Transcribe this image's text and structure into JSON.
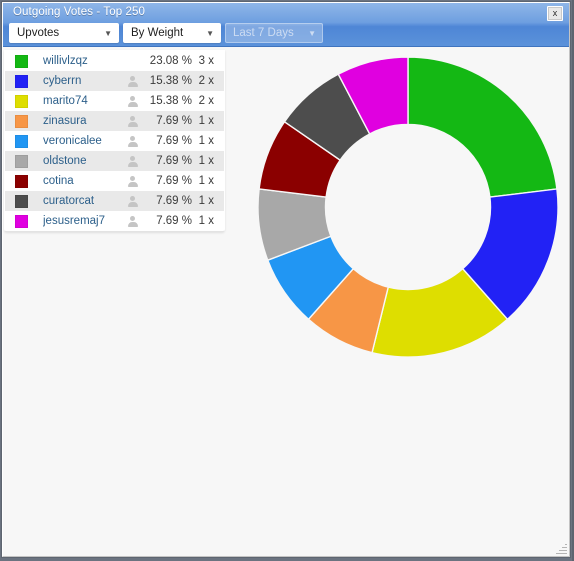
{
  "window": {
    "title": "Outgoing Votes - Top 250",
    "close_label": "x",
    "close_icon": "close-icon",
    "resize_grip_icon": "resize-grip-icon"
  },
  "toolbar": {
    "vote_type": {
      "value": "Upvotes",
      "arrow_icon": "chevron-down-icon"
    },
    "sort_mode": {
      "value": "By Weight",
      "arrow_icon": "chevron-down-icon"
    },
    "time_range": {
      "value": "Last 7 Days",
      "arrow_icon": "chevron-down-icon",
      "disabled": true
    }
  },
  "legend": {
    "rows": [
      {
        "color": "#14b814",
        "username": "willivlzqz",
        "percent": "23.08 %",
        "count": "3 x",
        "has_avatar": false,
        "avatar_icon": "person-icon"
      },
      {
        "color": "#2222f5",
        "username": "cyberrn",
        "percent": "15.38 %",
        "count": "2 x",
        "has_avatar": true,
        "avatar_icon": "person-icon"
      },
      {
        "color": "#dede00",
        "username": "marito74",
        "percent": "15.38 %",
        "count": "2 x",
        "has_avatar": true,
        "avatar_icon": "person-icon"
      },
      {
        "color": "#f79646",
        "username": "zinasura",
        "percent": "7.69 %",
        "count": "1 x",
        "has_avatar": true,
        "avatar_icon": "person-icon"
      },
      {
        "color": "#2196f3",
        "username": "veronicalee",
        "percent": "7.69 %",
        "count": "1 x",
        "has_avatar": true,
        "avatar_icon": "person-icon"
      },
      {
        "color": "#a8a8a8",
        "username": "oldstone",
        "percent": "7.69 %",
        "count": "1 x",
        "has_avatar": true,
        "avatar_icon": "person-icon"
      },
      {
        "color": "#8b0000",
        "username": "cotina",
        "percent": "7.69 %",
        "count": "1 x",
        "has_avatar": true,
        "avatar_icon": "person-icon"
      },
      {
        "color": "#4d4d4d",
        "username": "curatorcat",
        "percent": "7.69 %",
        "count": "1 x",
        "has_avatar": true,
        "avatar_icon": "person-icon"
      },
      {
        "color": "#e000e0",
        "username": "jesusremaj7",
        "percent": "7.69 %",
        "count": "1 x",
        "has_avatar": true,
        "avatar_icon": "person-icon"
      }
    ]
  },
  "chart_data": {
    "type": "pie",
    "variant": "donut",
    "title": "Outgoing Votes - Top 250",
    "start_angle_deg": 0,
    "direction": "clockwise",
    "inner_radius_ratio": 0.55,
    "categories": [
      "willivlzqz",
      "cyberrn",
      "marito74",
      "zinasura",
      "veronicalee",
      "oldstone",
      "cotina",
      "curatorcat",
      "jesusremaj7"
    ],
    "values": [
      23.08,
      15.38,
      15.38,
      7.69,
      7.69,
      7.69,
      7.69,
      7.69,
      7.69
    ],
    "counts": [
      3,
      2,
      2,
      1,
      1,
      1,
      1,
      1,
      1
    ],
    "value_unit": "%",
    "colors": [
      "#14b814",
      "#2222f5",
      "#dede00",
      "#f79646",
      "#2196f3",
      "#a8a8a8",
      "#8b0000",
      "#4d4d4d",
      "#e000e0"
    ],
    "legend_position": "left",
    "grid": false,
    "xlabel": "",
    "ylabel": ""
  },
  "theme": {
    "titlebar_top": "#8fb6e8",
    "titlebar_bottom": "#5b92da",
    "panel_bg": "#f7f7f7",
    "row_alt_bg": "#e9e9e9",
    "username_color": "#2c5f8a",
    "desktop_bg": "#6b7380"
  }
}
